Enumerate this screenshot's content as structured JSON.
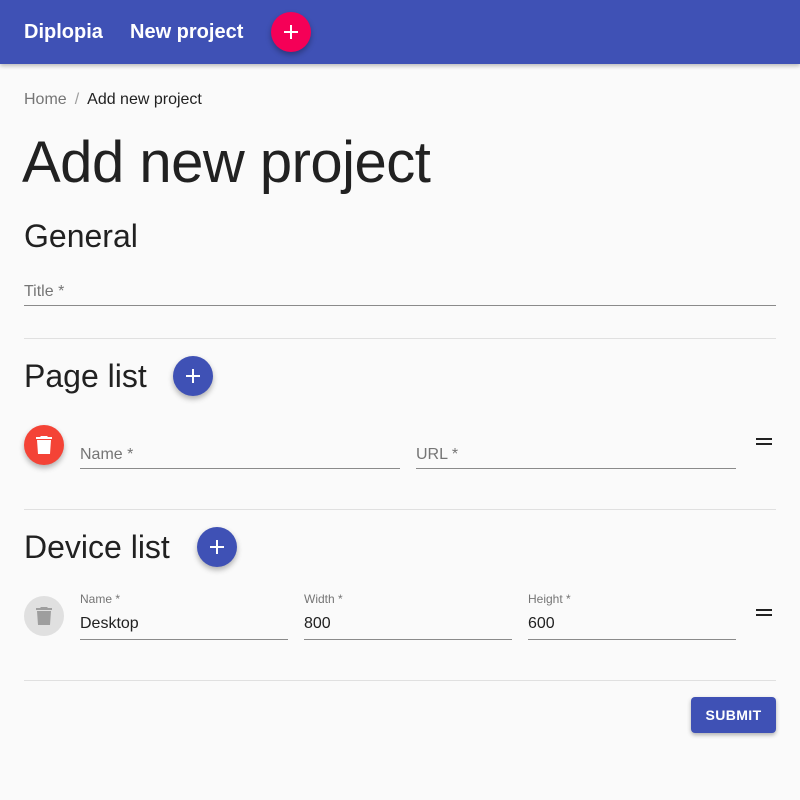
{
  "appbar": {
    "brand": "Diplopia",
    "nav_link": "New project",
    "accent": "#f50057",
    "background": "#3f51b5"
  },
  "breadcrumb": {
    "home": "Home",
    "separator": "/",
    "current": "Add new project"
  },
  "page_title": "Add new project",
  "general": {
    "heading": "General",
    "title_field": {
      "label": "Title *",
      "value": ""
    }
  },
  "page_list": {
    "heading": "Page list",
    "items": [
      {
        "name": {
          "label": "Name *",
          "value": ""
        },
        "url": {
          "label": "URL *",
          "value": ""
        }
      }
    ]
  },
  "device_list": {
    "heading": "Device list",
    "items": [
      {
        "name": {
          "label": "Name *",
          "value": "Desktop"
        },
        "width": {
          "label": "Width *",
          "value": "800"
        },
        "height": {
          "label": "Height *",
          "value": "600"
        }
      }
    ]
  },
  "submit_label": "SUBMIT",
  "icons": {
    "add": "plus-icon",
    "delete": "trash-icon",
    "drag": "drag-handle-icon"
  }
}
